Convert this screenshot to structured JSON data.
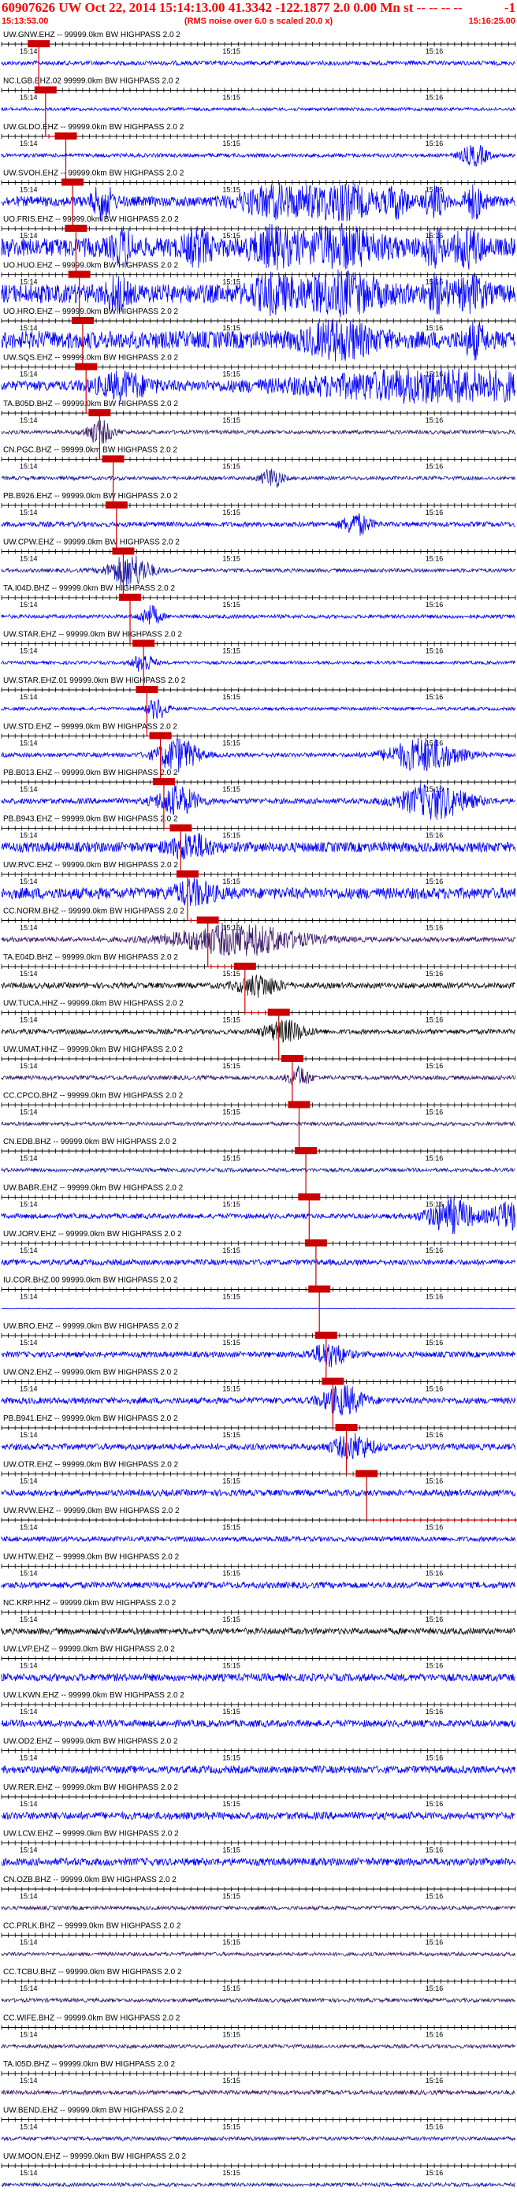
{
  "header": {
    "title": "60907626 UW Oct 22, 2014 15:14:13.00   41.3342 -122.1877  2.0 0.00 Mn st -- -- -- --",
    "right_code": "-1",
    "start_time": "15:13:53.00",
    "scale_note": "(RMS noise over 6.0 s scaled 20.0 x)",
    "end_time": "15:16:25.00"
  },
  "chart_data": {
    "type": "seismogram-stack",
    "start_time": "15:13:53",
    "end_time": "15:16:25",
    "minute_labels": [
      {
        "label": "15:14",
        "time": "15:14:00"
      },
      {
        "label": "15:15",
        "time": "15:15:00"
      },
      {
        "label": "15:16",
        "time": "15:16:00"
      }
    ],
    "filter_suffix": " 99999.0km BW  HIGHPASS  2.0  2",
    "colors": {
      "blue": "#0000ff",
      "navy": "#1a1aa0",
      "purple": "#3a1a6a",
      "black": "#101010",
      "pick": "#cc0000",
      "tick": "#000000"
    },
    "traces": [
      {
        "station": "UW.GNW.EHZ --",
        "color": "blue",
        "amp": 0.35,
        "pick": 11,
        "bursts": []
      },
      {
        "station": "NC.LGB.EHZ.02",
        "color": "blue",
        "amp": 0.25,
        "pick": 13,
        "bursts": []
      },
      {
        "station": "UW.GLDO.EHZ --",
        "color": "blue",
        "amp": 0.3,
        "pick": 19,
        "bursts": [
          [
            140,
            4,
            1.6
          ]
        ]
      },
      {
        "station": "UW.SVOH.EHZ --",
        "color": "blue",
        "amp": 0.8,
        "pick": 21,
        "bursts": [
          [
            30,
            3,
            2.6
          ],
          [
            80,
            10,
            2.0
          ],
          [
            100,
            12,
            2.4
          ],
          [
            117,
            3,
            2.0
          ],
          [
            128,
            3,
            2.2
          ],
          [
            140,
            3,
            2.3
          ]
        ]
      },
      {
        "station": "UO.FRIS.EHZ --",
        "color": "blue",
        "amp": 1.5,
        "pick": 22,
        "bursts": [
          [
            36,
            3,
            2.0
          ],
          [
            58,
            4,
            2.0
          ],
          [
            80,
            6,
            2.2
          ],
          [
            100,
            12,
            2.4
          ],
          [
            128,
            3,
            2.1
          ],
          [
            138,
            4,
            2.1
          ]
        ]
      },
      {
        "station": "UO.HUO.EHZ --",
        "color": "blue",
        "amp": 1.5,
        "pick": 23,
        "bursts": [
          [
            34,
            3,
            2.0
          ],
          [
            80,
            6,
            2.0
          ],
          [
            100,
            12,
            2.4
          ],
          [
            129,
            3,
            2.0
          ],
          [
            139,
            4,
            2.0
          ]
        ]
      },
      {
        "station": "UO.HRO.EHZ --",
        "color": "blue",
        "amp": 1.4,
        "pick": 24,
        "bursts": [
          [
            100,
            10,
            2.2
          ],
          [
            140,
            3,
            2.0
          ]
        ]
      },
      {
        "station": "UW.SQS.EHZ --",
        "color": "blue",
        "amp": 0.8,
        "pick": 25,
        "bursts": [
          [
            36,
            8,
            1.8
          ],
          [
            130,
            40,
            2.2
          ]
        ]
      },
      {
        "station": "TA.B05D.BHZ --",
        "color": "purple",
        "amp": 0.3,
        "pick": 29,
        "bursts": [
          [
            29,
            4,
            1.8
          ]
        ]
      },
      {
        "station": "CN.PGC.BHZ --",
        "color": "navy",
        "amp": 0.3,
        "pick": 33,
        "bursts": [
          [
            80,
            3,
            1.6
          ]
        ]
      },
      {
        "station": "PB.B926.EHZ --",
        "color": "blue",
        "amp": 0.4,
        "pick": 34,
        "bursts": [
          [
            105,
            4,
            1.6
          ]
        ]
      },
      {
        "station": "UW.CPW.EHZ --",
        "color": "navy",
        "amp": 0.3,
        "pick": 36,
        "bursts": [
          [
            38,
            6,
            2.6
          ]
        ]
      },
      {
        "station": "TA.I04D.BHZ --",
        "color": "blue",
        "amp": 0.3,
        "pick": 38,
        "bursts": [
          [
            44,
            3,
            1.6
          ]
        ]
      },
      {
        "station": "UW.STAR.EHZ --",
        "color": "blue",
        "amp": 0.25,
        "pick": 42,
        "bursts": [
          [
            42,
            3,
            1.6
          ]
        ]
      },
      {
        "station": "UW.STAR.EHZ.01",
        "color": "blue",
        "amp": 0.25,
        "pick": 43,
        "bursts": [
          [
            46,
            3,
            1.6
          ]
        ]
      },
      {
        "station": "UW.STD.EHZ --",
        "color": "blue",
        "amp": 0.35,
        "pick": 47,
        "bursts": [
          [
            52,
            6,
            2.6
          ],
          [
            125,
            10,
            2.6
          ]
        ]
      },
      {
        "station": "PB.B013.EHZ --",
        "color": "blue",
        "amp": 0.45,
        "pick": 48,
        "bursts": [
          [
            52,
            6,
            2.2
          ],
          [
            128,
            10,
            2.6
          ]
        ]
      },
      {
        "station": "PB.B943.EHZ --",
        "color": "blue",
        "amp": 0.8,
        "pick": 53,
        "bursts": [
          [
            56,
            6,
            1.8
          ]
        ]
      },
      {
        "station": "UW.RVC.EHZ --",
        "color": "blue",
        "amp": 0.9,
        "pick": 55,
        "bursts": [
          [
            57,
            6,
            1.6
          ]
        ]
      },
      {
        "station": "CC.NORM.BHZ --",
        "color": "purple",
        "amp": 0.4,
        "pick": 61,
        "bursts": [
          [
            70,
            18,
            2.4
          ]
        ]
      },
      {
        "station": "TA.E04D.BHZ --",
        "color": "black",
        "amp": 0.45,
        "pick": 72,
        "bursts": [
          [
            76,
            6,
            1.6
          ]
        ]
      },
      {
        "station": "UW.TUCA.HHZ --",
        "color": "black",
        "amp": 0.4,
        "pick": 82,
        "bursts": [
          [
            84,
            6,
            1.6
          ]
        ]
      },
      {
        "station": "UW.UMAT.HHZ --",
        "color": "purple",
        "amp": 0.35,
        "pick": 86,
        "bursts": [
          [
            88,
            3,
            1.6
          ]
        ]
      },
      {
        "station": "CC.CPCO.BHZ --",
        "color": "purple",
        "amp": 0.3,
        "pick": 88,
        "bursts": []
      },
      {
        "station": "CN.EDB.BHZ --",
        "color": "navy",
        "amp": 0.3,
        "pick": 90,
        "bursts": []
      },
      {
        "station": "UW.BABR.EHZ --",
        "color": "blue",
        "amp": 0.4,
        "pick": 91,
        "bursts": [
          [
            133,
            7,
            2.6
          ],
          [
            150,
            5,
            2.2
          ]
        ]
      },
      {
        "station": "UW.JORV.EHZ --",
        "color": "blue",
        "amp": 0.45,
        "pick": 93,
        "bursts": []
      },
      {
        "station": "IU.COR.BHZ.00",
        "color": "blue",
        "amp": 0.05,
        "pick": 94,
        "bursts": []
      },
      {
        "station": "UW.BRO.EHZ --",
        "color": "blue",
        "amp": 0.45,
        "pick": 96,
        "bursts": [
          [
            97,
            5,
            1.8
          ]
        ]
      },
      {
        "station": "UW.ON2.EHZ --",
        "color": "blue",
        "amp": 0.5,
        "pick": 98,
        "bursts": [
          [
            101,
            6,
            2.2
          ]
        ]
      },
      {
        "station": "PB.B941.EHZ --",
        "color": "blue",
        "amp": 0.5,
        "pick": 102,
        "bursts": [
          [
            104,
            6,
            1.8
          ]
        ]
      },
      {
        "station": "UW.OTR.EHZ --",
        "color": "blue",
        "amp": 0.5,
        "pick": 108,
        "bursts": []
      },
      {
        "station": "UW.RVW.EHZ --",
        "color": "blue",
        "amp": 0.4,
        "pick": 159,
        "bursts": []
      },
      {
        "station": "UW.HTW.EHZ --",
        "color": "blue",
        "amp": 0.5,
        "pick": 165,
        "bursts": []
      },
      {
        "station": "NC.KRP.HHZ --",
        "color": "black",
        "amp": 0.5,
        "pick": 172,
        "bursts": []
      },
      {
        "station": "UW.LVP.EHZ --",
        "color": "blue",
        "amp": 0.6,
        "pick": 178,
        "bursts": [
          [
            181,
            4,
            1.6
          ]
        ]
      },
      {
        "station": "UW.LKWN.EHZ --",
        "color": "blue",
        "amp": 0.55,
        "pick": 179,
        "bursts": [
          [
            182,
            4,
            1.6
          ]
        ]
      },
      {
        "station": "UW.OD2.EHZ --",
        "color": "blue",
        "amp": 0.6,
        "pick": 180,
        "bursts": [
          [
            183,
            4,
            1.8
          ]
        ]
      },
      {
        "station": "UW.RER.EHZ --",
        "color": "blue",
        "amp": 0.6,
        "pick": 182,
        "bursts": [
          [
            184,
            4,
            1.8
          ]
        ]
      },
      {
        "station": "UW.LCW.EHZ --",
        "color": "blue",
        "amp": 0.6,
        "pick": 185,
        "bursts": [
          [
            187,
            3,
            1.6
          ]
        ]
      },
      {
        "station": "CN.OZB.BHZ --",
        "color": "purple",
        "amp": 0.3,
        "pick": null,
        "bursts": []
      },
      {
        "station": "CC.PRLK.BHZ --",
        "color": "purple",
        "amp": 0.3,
        "pick": null,
        "bursts": []
      },
      {
        "station": "CC.TCBU.BHZ --",
        "color": "purple",
        "amp": 0.3,
        "pick": null,
        "bursts": []
      },
      {
        "station": "CC.WIFE.BHZ --",
        "color": "purple",
        "amp": 0.3,
        "pick": null,
        "bursts": []
      },
      {
        "station": "TA.I05D.BHZ --",
        "color": "purple",
        "amp": 0.35,
        "pick": null,
        "bursts": []
      },
      {
        "station": "UW.BEND.EHZ --",
        "color": "navy",
        "amp": 0.3,
        "pick": null,
        "bursts": []
      },
      {
        "station": "UW.MOON.EHZ --",
        "color": "navy",
        "amp": 0.3,
        "pick": null,
        "bursts": []
      }
    ]
  }
}
